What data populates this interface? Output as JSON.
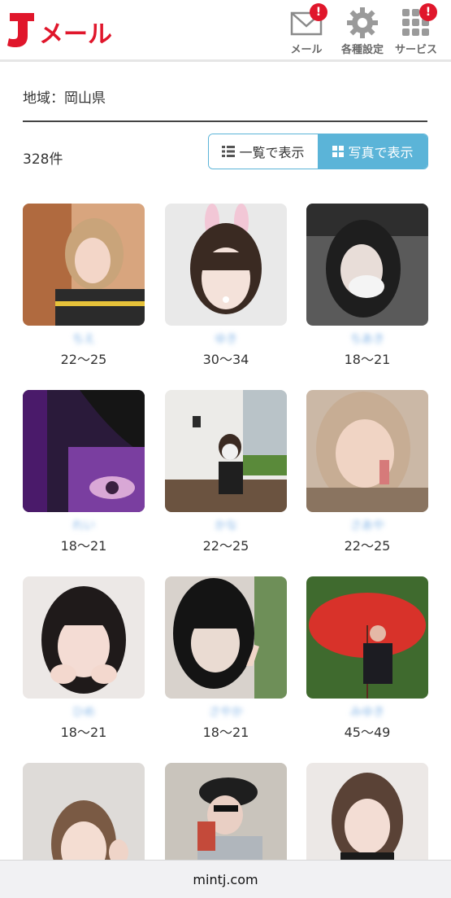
{
  "header": {
    "logo_text": "Jメール",
    "mail_label": "メール",
    "settings_label": "各種設定",
    "service_label": "サービス",
    "badge_text": "!",
    "accent_color": "#e0162b"
  },
  "region": {
    "label": "地域：岡山県"
  },
  "results": {
    "count": "328件"
  },
  "view_toggle": {
    "list_label": "一覧で表示",
    "photo_label": "写真で表示",
    "selected": "photo",
    "active_color": "#5bb4d8"
  },
  "profiles": [
    {
      "name": "ちえ",
      "age": "22〜25"
    },
    {
      "name": "ゆき",
      "age": "30〜34"
    },
    {
      "name": "ちあき",
      "age": "18〜21"
    },
    {
      "name": "れい",
      "age": "18〜21"
    },
    {
      "name": "かな",
      "age": "22〜25"
    },
    {
      "name": "さあや",
      "age": "22〜25"
    },
    {
      "name": "ひめ",
      "age": "18〜21"
    },
    {
      "name": "さやか",
      "age": "18〜21"
    },
    {
      "name": "みゆき",
      "age": "45〜49"
    },
    {
      "name": "",
      "age": ""
    },
    {
      "name": "",
      "age": ""
    },
    {
      "name": "",
      "age": ""
    }
  ],
  "browser": {
    "url": "mintj.com"
  }
}
